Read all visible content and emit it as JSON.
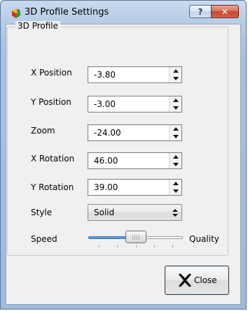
{
  "window": {
    "title": "3D Profile Settings",
    "app_icon": "colorful-3d-app-icon",
    "help_label": "?",
    "close_label": "✕"
  },
  "group": {
    "title": "3D Profile"
  },
  "fields": [
    {
      "label": "X Position",
      "value": "-3.80"
    },
    {
      "label": "Y Position",
      "value": "-3.00"
    },
    {
      "label": "Zoom",
      "value": "-24.00"
    },
    {
      "label": "X Rotation",
      "value": "46.00"
    },
    {
      "label": "Y Rotation",
      "value": "39.00"
    }
  ],
  "style": {
    "label": "Style",
    "value": "Solid"
  },
  "slider": {
    "left_label": "Speed",
    "right_label": "Quality",
    "value_fraction": 0.5,
    "ticks": 5
  },
  "buttons": {
    "close_label": "Close",
    "close_icon": "x-mark-icon"
  },
  "colors": {
    "titlebar": "#b6cde7",
    "close_red": "#c24a2c",
    "slider_fill": "#3c8ad6"
  }
}
